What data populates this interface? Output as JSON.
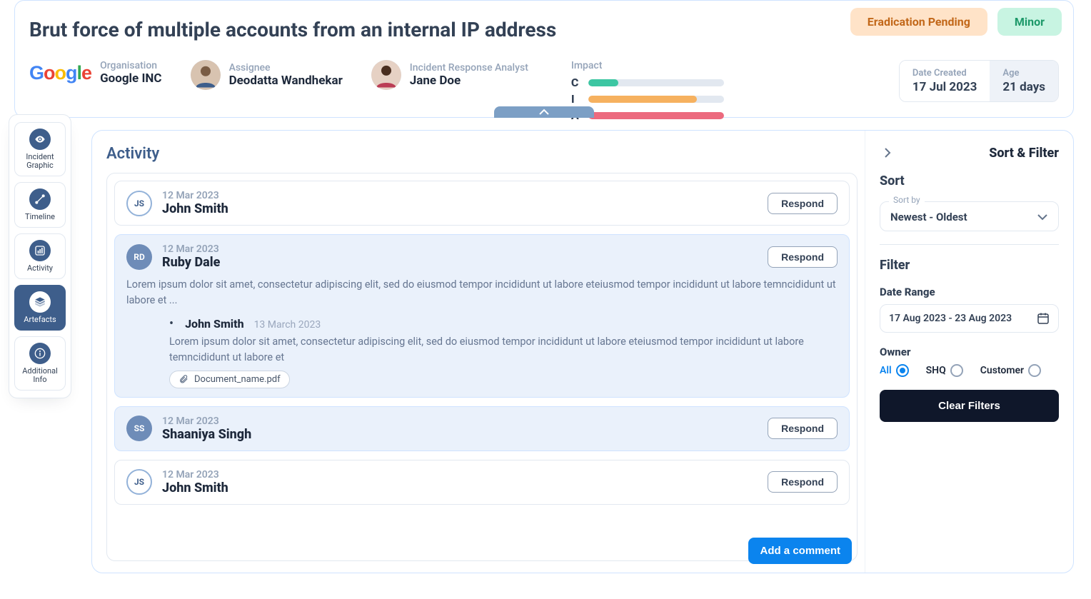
{
  "incident": {
    "title": "Brut force of multiple accounts from an internal IP address",
    "status_label": "Eradication Pending",
    "severity_label": "Minor",
    "organisation_label": "Organisation",
    "organisation_value": "Google INC",
    "assignee_label": "Assignee",
    "assignee_value": "Deodatta Wandhekar",
    "analyst_label": "Incident Response Analyst",
    "analyst_value": "Jane Doe",
    "impact_label": "Impact",
    "impact": {
      "c": {
        "letter": "C",
        "pct": 22,
        "color": "#3cc6a2"
      },
      "i": {
        "letter": "I",
        "pct": 80,
        "color": "#f6b15f"
      },
      "a": {
        "letter": "A",
        "pct": 100,
        "color": "#ec6a7e"
      }
    },
    "date_created_label": "Date Created",
    "date_created_value": "17 Jul 2023",
    "age_label": "Age",
    "age_value": "21 days"
  },
  "sidenav": {
    "items": [
      {
        "label": "Incident\nGraphic",
        "icon": "eye-icon"
      },
      {
        "label": "Timeline",
        "icon": "path-icon"
      },
      {
        "label": "Activity",
        "icon": "chart-icon"
      },
      {
        "label": "Artefacts",
        "icon": "layers-icon"
      },
      {
        "label": "Additional\nInfo",
        "icon": "info-icon"
      }
    ],
    "active_index": 3
  },
  "activity": {
    "title": "Activity",
    "respond_label": "Respond",
    "add_comment_label": "Add a comment",
    "entries": [
      {
        "date": "12 Mar 2023",
        "name": "John Smith",
        "initials": "JS",
        "avatar_style": "outline"
      },
      {
        "date": "12 Mar 2023",
        "name": "Ruby Dale",
        "initials": "RD",
        "avatar_style": "solid",
        "body": "Lorem ipsum dolor sit amet, consectetur adipiscing elit, sed do eiusmod tempor incididunt ut labore eteiusmod tempor incididunt ut labore temncididunt ut labore et ...",
        "reply": {
          "name": "John Smith",
          "date": "13 March 2023",
          "body": "Lorem ipsum dolor sit amet, consectetur adipiscing elit, sed do eiusmod tempor incididunt ut labore eteiusmod tempor incididunt ut labore temncididunt ut labore et",
          "attachment": "Document_name.pdf"
        }
      },
      {
        "date": "12 Mar 2023",
        "name": "Shaaniya Singh",
        "initials": "SS",
        "avatar_style": "solid"
      },
      {
        "date": "12 Mar 2023",
        "name": "John Smith",
        "initials": "JS",
        "avatar_style": "outline"
      }
    ]
  },
  "filter": {
    "header_title": "Sort & Filter",
    "sort_section": "Sort",
    "sort_by_legend": "Sort by",
    "sort_by_value": "Newest - Oldest",
    "filter_section": "Filter",
    "date_range_label": "Date Range",
    "date_range_value": "17 Aug 2023 - 23 Aug 2023",
    "owner_label": "Owner",
    "owner_options": {
      "all": "All",
      "shq": "SHQ",
      "customer": "Customer"
    },
    "owner_selected": "all",
    "clear_label": "Clear Filters"
  }
}
